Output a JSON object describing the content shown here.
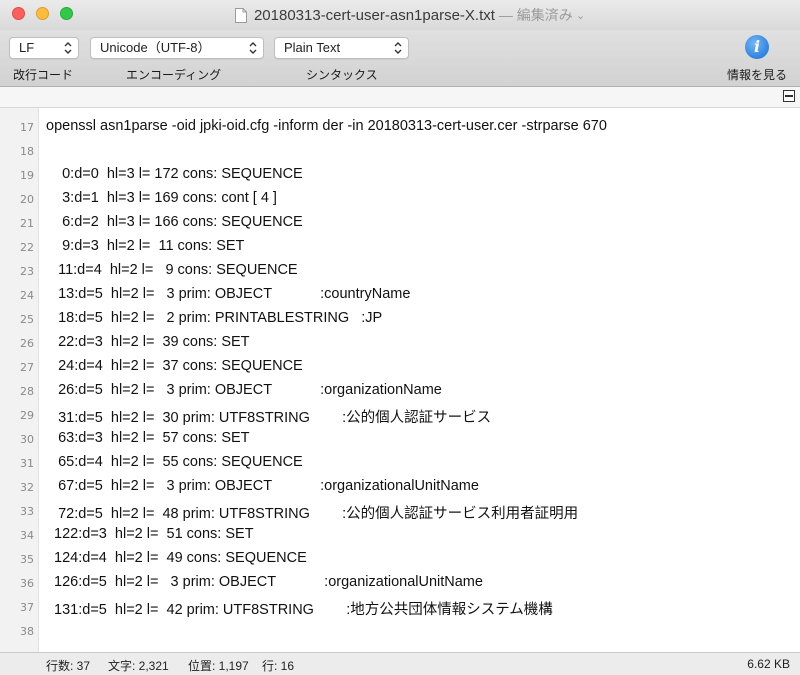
{
  "window": {
    "title": "20180313-cert-user-asn1parse-X.txt",
    "status": "— 編集済み"
  },
  "toolbar": {
    "line_ending": {
      "value": "LF",
      "label": "改行コード"
    },
    "encoding": {
      "value": "Unicode（UTF-8）",
      "label": "エンコーディング"
    },
    "syntax": {
      "value": "Plain Text",
      "label": "シンタックス"
    },
    "info": {
      "label": "情報を見る"
    }
  },
  "editor": {
    "lines": [
      {
        "num": "17",
        "text": "openssl asn1parse -oid jpki-oid.cfg -inform der -in 20180313-cert-user.cer -strparse 670"
      },
      {
        "num": "18",
        "text": ""
      },
      {
        "num": "19",
        "text": "    0:d=0  hl=3 l= 172 cons: SEQUENCE"
      },
      {
        "num": "20",
        "text": "    3:d=1  hl=3 l= 169 cons: cont [ 4 ]"
      },
      {
        "num": "21",
        "text": "    6:d=2  hl=3 l= 166 cons: SEQUENCE"
      },
      {
        "num": "22",
        "text": "    9:d=3  hl=2 l=  11 cons: SET"
      },
      {
        "num": "23",
        "text": "   11:d=4  hl=2 l=   9 cons: SEQUENCE"
      },
      {
        "num": "24",
        "text": "   13:d=5  hl=2 l=   3 prim: OBJECT            :countryName"
      },
      {
        "num": "25",
        "text": "   18:d=5  hl=2 l=   2 prim: PRINTABLESTRING   :JP"
      },
      {
        "num": "26",
        "text": "   22:d=3  hl=2 l=  39 cons: SET"
      },
      {
        "num": "27",
        "text": "   24:d=4  hl=2 l=  37 cons: SEQUENCE"
      },
      {
        "num": "28",
        "text": "   26:d=5  hl=2 l=   3 prim: OBJECT            :organizationName"
      },
      {
        "num": "29",
        "text": "   31:d=5  hl=2 l=  30 prim: UTF8STRING        :公的個人認証サービス"
      },
      {
        "num": "30",
        "text": "   63:d=3  hl=2 l=  57 cons: SET"
      },
      {
        "num": "31",
        "text": "   65:d=4  hl=2 l=  55 cons: SEQUENCE"
      },
      {
        "num": "32",
        "text": "   67:d=5  hl=2 l=   3 prim: OBJECT            :organizationalUnitName"
      },
      {
        "num": "33",
        "text": "   72:d=5  hl=2 l=  48 prim: UTF8STRING        :公的個人認証サービス利用者証明用"
      },
      {
        "num": "34",
        "text": "  122:d=3  hl=2 l=  51 cons: SET"
      },
      {
        "num": "35",
        "text": "  124:d=4  hl=2 l=  49 cons: SEQUENCE"
      },
      {
        "num": "36",
        "text": "  126:d=5  hl=2 l=   3 prim: OBJECT            :organizationalUnitName"
      },
      {
        "num": "37",
        "text": "  131:d=5  hl=2 l=  42 prim: UTF8STRING        :地方公共団体情報システム機構"
      },
      {
        "num": "38",
        "text": ""
      }
    ]
  },
  "statusbar": {
    "lines": "行数: 37",
    "chars": "文字: 2,321",
    "position": "位置: 1,197",
    "row": "行: 16",
    "size": "6.62 KB"
  }
}
